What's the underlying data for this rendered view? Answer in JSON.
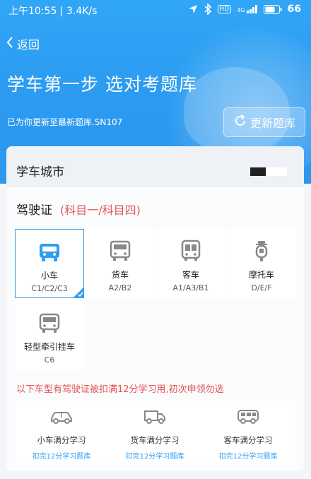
{
  "status_bar": {
    "time_speed": "上午10:55 | 3.4K/s",
    "signal": "4G",
    "hd": "HD",
    "battery": "66"
  },
  "nav": {
    "back_label": "返回"
  },
  "hero": {
    "title": "学车第一步 选对考题库",
    "info": "已为你更新至最新题库.SN107",
    "update_button": "更新题库"
  },
  "city": {
    "label": "学车城市"
  },
  "license": {
    "label": "驾驶证",
    "subjects": "(科目一/科目四)",
    "types": [
      {
        "name": "小车",
        "code": "C1/C2/C3",
        "icon": "car-icon",
        "selected": true
      },
      {
        "name": "货车",
        "code": "A2/B2",
        "icon": "truck-icon",
        "selected": false
      },
      {
        "name": "客车",
        "code": "A1/A3/B1",
        "icon": "bus-icon",
        "selected": false
      },
      {
        "name": "摩托车",
        "code": "D/E/F",
        "icon": "motorcycle-icon",
        "selected": false
      },
      {
        "name": "轻型牵引挂车",
        "code": "C6",
        "icon": "trailer-truck-icon",
        "selected": false
      }
    ]
  },
  "notice": "以下车型有驾驶证被扣满12分学习用,初次申领勿选",
  "full_score": [
    {
      "name": "小车满分学习",
      "link": "扣完12分学习题库",
      "icon": "car-outline-icon"
    },
    {
      "name": "货车满分学习",
      "link": "扣完12分学习题库",
      "icon": "truck-outline-icon"
    },
    {
      "name": "客车满分学习",
      "link": "扣完12分学习题库",
      "icon": "bus-outline-icon"
    }
  ],
  "colors": {
    "accent": "#2f9ef2",
    "warning": "#e45353",
    "header": "#2b9af0"
  }
}
